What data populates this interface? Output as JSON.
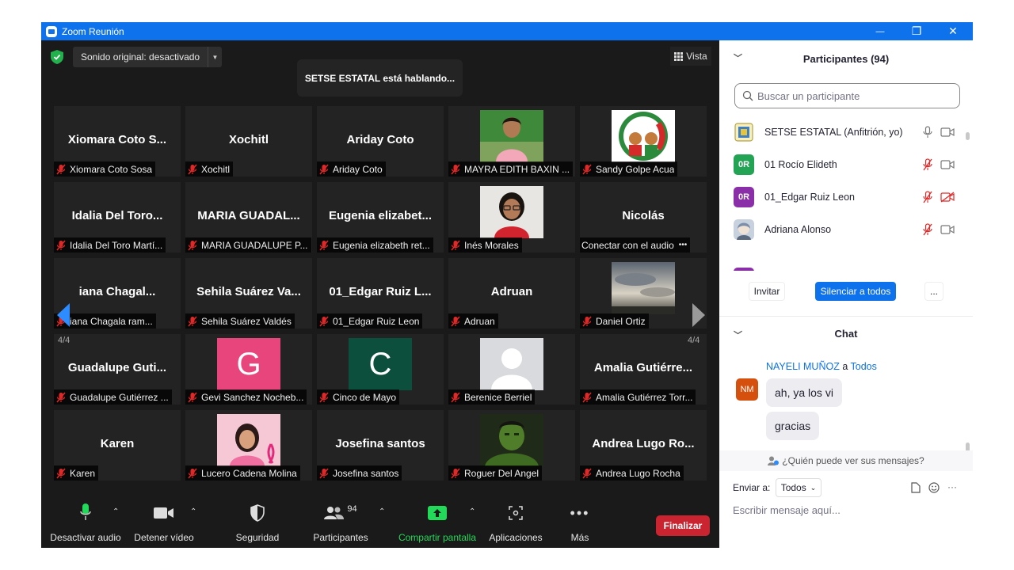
{
  "window": {
    "title": "Zoom Reunión",
    "controls": {
      "minimize": "—",
      "restore": "❐",
      "close": "✕"
    }
  },
  "video": {
    "audio_pill": "Sonido original: desactivado",
    "speaking_banner": "SETSE ESTATAL está hablando...",
    "view_label": "Vista",
    "page_indicator_left": "4/4",
    "page_indicator_right": "4/4",
    "tiles": [
      {
        "big": "Xiomara Coto S...",
        "label": "Xiomara Coto Sosa",
        "muted": true
      },
      {
        "big": "Xochitl",
        "label": "Xochitl",
        "muted": true
      },
      {
        "big": "Ariday Coto",
        "label": "Ariday Coto",
        "muted": true
      },
      {
        "big": "",
        "label": "MAYRA EDITH BAXIN ...",
        "muted": true,
        "pic": "woman-photo"
      },
      {
        "big": "",
        "label": "Sandy Golpe Acua",
        "muted": true,
        "pic": "emblem-logo"
      },
      {
        "big": "Idalia Del Toro...",
        "label": "Idalia Del Toro Martí...",
        "muted": true
      },
      {
        "big": "MARIA GUADAL...",
        "label": "MARIA GUADALUPE P...",
        "muted": true
      },
      {
        "big": "Eugenia elizabet...",
        "label": "Eugenia elizabeth ret...",
        "muted": true
      },
      {
        "big": "",
        "label": "Inés Morales",
        "muted": true,
        "pic": "woman-glasses-photo"
      },
      {
        "big": "Nicolás",
        "label": "Conectar con el audio",
        "muted": false
      },
      {
        "big": "iana Chagal...",
        "label": "iana Chagala ram...",
        "muted": true
      },
      {
        "big": "Sehila Suárez Va...",
        "label": "Sehila Suárez Valdés",
        "muted": true
      },
      {
        "big": "01_Edgar Ruiz L...",
        "label": "01_Edgar Ruiz Leon",
        "muted": true
      },
      {
        "big": "Adruan",
        "label": "Adruan",
        "muted": true
      },
      {
        "big": "",
        "label": "Daniel Ortiz",
        "muted": true,
        "pic": "sky-photo"
      },
      {
        "big": "Guadalupe Guti...",
        "label": "Guadalupe Gutiérrez ...",
        "muted": true
      },
      {
        "big": "",
        "label": "Gevi Sanchez Nocheb...",
        "muted": true,
        "pic": "letter-g",
        "letter": "G",
        "color": "#e8457c"
      },
      {
        "big": "",
        "label": "Cinco de Mayo",
        "muted": true,
        "pic": "letter-c",
        "letter": "C",
        "color": "#0b4f3c"
      },
      {
        "big": "",
        "label": "Berenice Berriel",
        "muted": true,
        "pic": "default-avatar"
      },
      {
        "big": "Amalia Gutiérre...",
        "label": "Amalia Gutiérrez Torr...",
        "muted": true
      },
      {
        "big": "Karen",
        "label": "Karen",
        "muted": true
      },
      {
        "big": "",
        "label": "Lucero Cadena Molina",
        "muted": true,
        "pic": "pink-ribbon-photo"
      },
      {
        "big": "Josefina santos",
        "label": "Josefina santos",
        "muted": true
      },
      {
        "big": "",
        "label": "Roguer Del Angel",
        "muted": true,
        "pic": "hulk-photo"
      },
      {
        "big": "Andrea Lugo Ro...",
        "label": "Andrea Lugo Rocha",
        "muted": true
      }
    ]
  },
  "toolbar": {
    "mute": "Desactivar audio",
    "video": "Detener vídeo",
    "security": "Seguridad",
    "participants": "Participantes",
    "participants_count": "94",
    "share": "Compartir pantalla",
    "apps": "Aplicaciones",
    "more": "Más",
    "end": "Finalizar"
  },
  "participants_panel": {
    "title": "Participantes (94)",
    "search_placeholder": "Buscar un participante",
    "list": [
      {
        "initials": "",
        "name": "SETSE ESTATAL (Anfitrión, yo)",
        "color": "#ffffff",
        "mic": "on",
        "cam": "on"
      },
      {
        "initials": "0R",
        "name": "01 Rocío Elideth",
        "color": "#23a455",
        "mic": "muted",
        "cam": "on"
      },
      {
        "initials": "0R",
        "name": "01_Edgar Ruiz Leon",
        "color": "#8a2fa8",
        "mic": "muted",
        "cam": "off"
      },
      {
        "initials": "",
        "name": "Adriana Alonso",
        "color": "#9fb0c4",
        "mic": "muted",
        "cam": "on"
      }
    ],
    "invite": "Invitar",
    "mute_all": "Silenciar a todos",
    "more": "..."
  },
  "chat": {
    "title": "Chat",
    "sender": "NAYELI MUÑOZ",
    "to_word": "a",
    "recipient": "Todos",
    "avatar_initials": "NM",
    "messages": [
      "ah, ya los vi",
      "gracias"
    ],
    "who_can_see": "¿Quién puede ver sus mensajes?",
    "send_to_label": "Enviar a:",
    "send_to_value": "Todos",
    "input_placeholder": "Escribir mensaje aquí..."
  },
  "colors": {
    "title_blue": "#0e72ed",
    "muted_red": "#e02828",
    "end_red": "#c92430",
    "share_green": "#23d959",
    "mute_all_blue": "#0e72ed"
  }
}
